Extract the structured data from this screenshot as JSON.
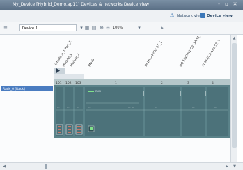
{
  "window": {
    "title": "My_Device [Hybrid_Demo.ap11]  Devices & networks  Device view",
    "controls": [
      "-",
      "▫",
      "✕"
    ]
  },
  "view_tabs": {
    "network": "Network view",
    "device": "Device view"
  },
  "toolbar": {
    "device_selector": "Device 1",
    "zoom": "100%"
  },
  "modules": {
    "column_titles": [
      "Interface_1 Port_1",
      "Module_1",
      "Module_2",
      "PN-IO",
      "DI 16x24VDC ST_1",
      "DQ 16x24VDC/0.5A ST_1",
      "AI 4xU/I 2-wire ST_1"
    ],
    "slot_headers": [
      "101",
      "102",
      "103",
      "1",
      "2",
      "3",
      "4"
    ]
  },
  "rack": {
    "label": "Rack_0 [Rack]",
    "status_text": "RUN"
  },
  "colors": {
    "title_bar": "#5b7086",
    "rack": "#5a8289",
    "rack_slot": "#4c727a",
    "header_row": "#b5c7ca",
    "selection": "#4a7cc0"
  }
}
